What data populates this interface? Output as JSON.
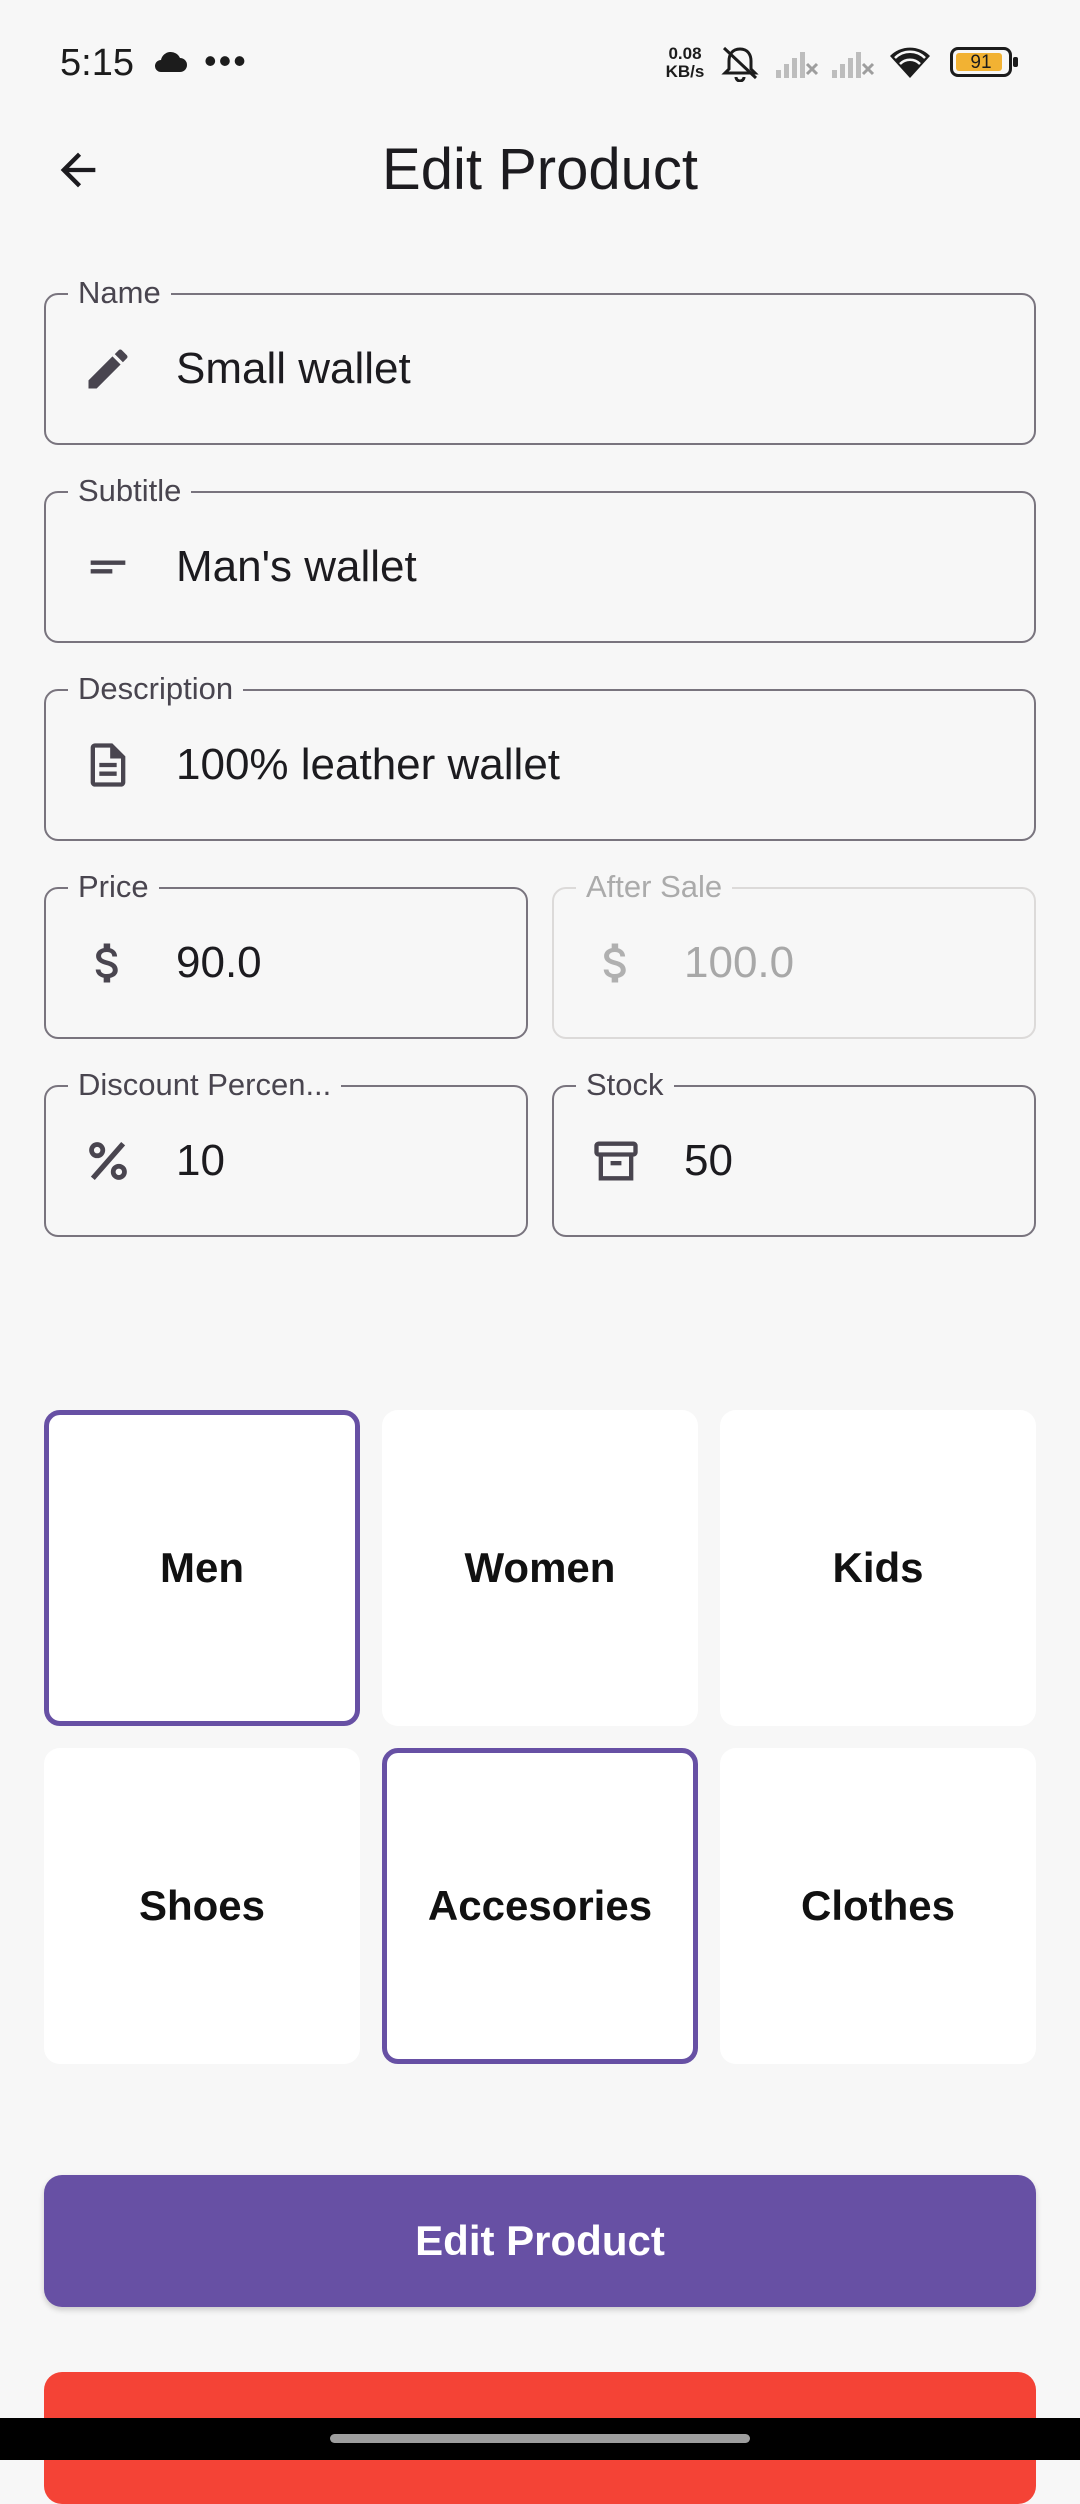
{
  "status_bar": {
    "time": "5:15",
    "dots": "•••",
    "speed_value": "0.08",
    "speed_unit": "KB/s",
    "battery": "91"
  },
  "header": {
    "title": "Edit Product",
    "back_icon": "arrow-left-icon"
  },
  "fields": {
    "name": {
      "label": "Name",
      "value": "Small wallet",
      "icon": "pencil-icon"
    },
    "subtitle": {
      "label": "Subtitle",
      "value": "Man's wallet",
      "icon": "short-text-icon"
    },
    "description": {
      "label": "Description",
      "value": "100% leather wallet",
      "icon": "document-icon"
    },
    "price": {
      "label": "Price",
      "value": "90.0",
      "icon": "dollar-icon"
    },
    "after_sale": {
      "label": "After Sale",
      "value": "100.0",
      "icon": "dollar-icon",
      "disabled": true
    },
    "discount": {
      "label": "Discount Percen...",
      "value": "10",
      "icon": "percent-icon"
    },
    "stock": {
      "label": "Stock",
      "value": "50",
      "icon": "archive-box-icon"
    }
  },
  "categories": [
    {
      "label": "Men",
      "selected": true
    },
    {
      "label": "Women",
      "selected": false
    },
    {
      "label": "Kids",
      "selected": false
    },
    {
      "label": "Shoes",
      "selected": false
    },
    {
      "label": "Accesories",
      "selected": true
    },
    {
      "label": "Clothes",
      "selected": false
    }
  ],
  "actions": {
    "edit_label": "Edit Product"
  },
  "colors": {
    "accent": "#6750a4",
    "danger": "#f44336",
    "background": "#f7f7f7"
  }
}
